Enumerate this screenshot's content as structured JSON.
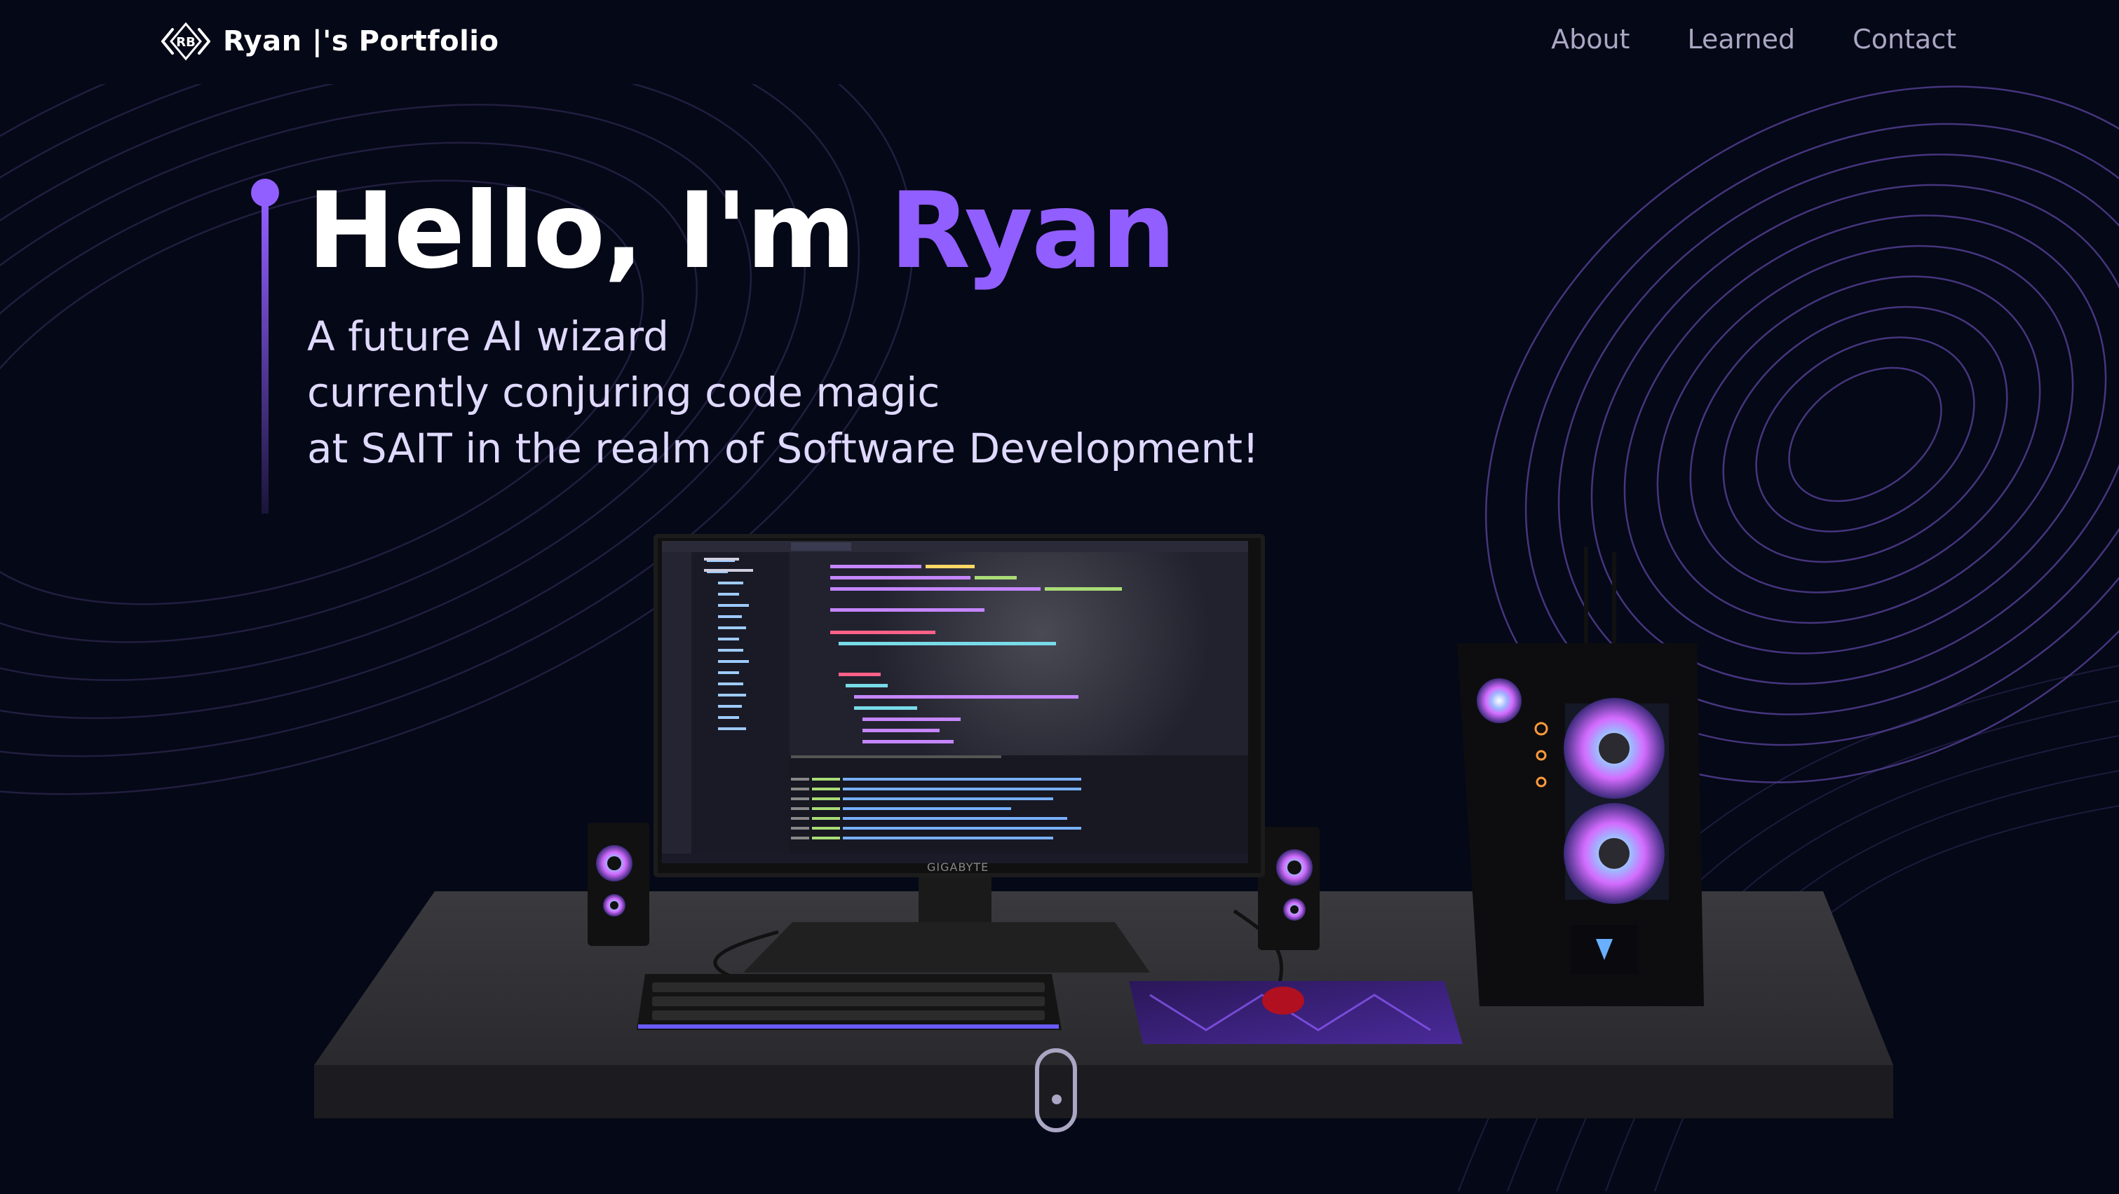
{
  "navbar": {
    "brand": "Ryan |'s Portfolio",
    "logo_text": "RB",
    "links": [
      {
        "label": "About"
      },
      {
        "label": "Learned"
      },
      {
        "label": "Contact"
      }
    ]
  },
  "hero": {
    "greeting": "Hello, I'm",
    "name": "Ryan",
    "subtitle_lines": [
      "A future AI wizard",
      "currently conjuring code magic",
      "at SAIT in the realm of Software Development!"
    ]
  },
  "scene": {
    "monitor_brand": "GIGABYTE"
  },
  "colors": {
    "background": "#050816",
    "accent": "#915eff",
    "text_primary": "#ffffff",
    "text_secondary": "#aaa6c3"
  },
  "icons": {
    "logo": "rb-diamond-logo-icon",
    "scroll": "scroll-indicator-icon"
  }
}
